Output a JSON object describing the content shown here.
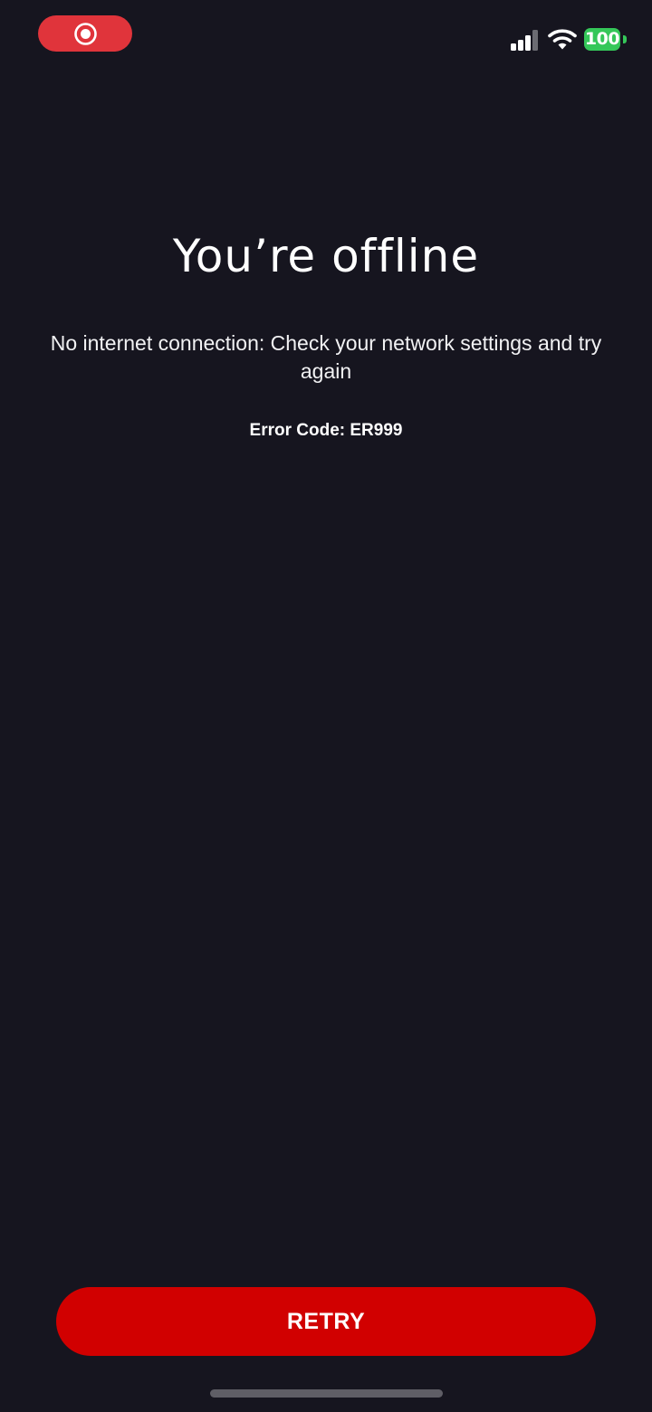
{
  "status_bar": {
    "recording_icon": "record-icon",
    "signal_icon": "cellular-signal-icon",
    "wifi_icon": "wifi-icon",
    "battery_level": "100",
    "colors": {
      "recording": "#e0343b",
      "battery": "#35c759"
    }
  },
  "offline": {
    "title": "You’re offline",
    "message": "No internet connection: Check your network settings and try again",
    "error_code": "Error Code: ER999"
  },
  "actions": {
    "retry_label": "RETRY"
  },
  "colors": {
    "background": "#16151f",
    "accent": "#d10000",
    "text": "#ffffff"
  }
}
